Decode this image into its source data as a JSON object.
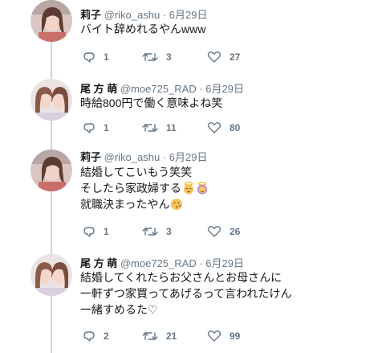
{
  "tweets": [
    {
      "name": "莉子",
      "handle": "@riko_ashu",
      "date": "· 6月29日",
      "lines": [
        "バイト辞めれるやんwww"
      ],
      "replies": "1",
      "retweets": "3",
      "likes": "27"
    },
    {
      "name": "尾 方 萌",
      "handle": "@moe725_RAD",
      "date": "· 6月29日",
      "lines": [
        "時給800円で働く意味よね笑"
      ],
      "replies": "1",
      "retweets": "11",
      "likes": "80"
    },
    {
      "name": "莉子",
      "handle": "@riko_ashu",
      "date": "· 6月29日",
      "lines": [
        "結婚してこいもう笑笑",
        "そしたら家政婦する",
        "就職決まったやん"
      ],
      "emojis": [
        "angel-emoji",
        "angel-emoji",
        "kiss-emoji"
      ],
      "replies": "1",
      "retweets": "3",
      "likes": "26"
    },
    {
      "name": "尾 方 萌",
      "handle": "@moe725_RAD",
      "date": "· 6月29日",
      "lines": [
        "結婚してくれたらお父さんとお母さんに",
        "一軒ずつ家買ってあげるって言われたけん",
        "一緒すめるた♡"
      ],
      "replies": "2",
      "retweets": "21",
      "likes": "99"
    }
  ],
  "icons": [
    "reply-icon",
    "retweet-icon",
    "heart-icon"
  ],
  "colors": {
    "text": "#14171a",
    "muted": "#657786",
    "thread": "#ccd6dd"
  }
}
